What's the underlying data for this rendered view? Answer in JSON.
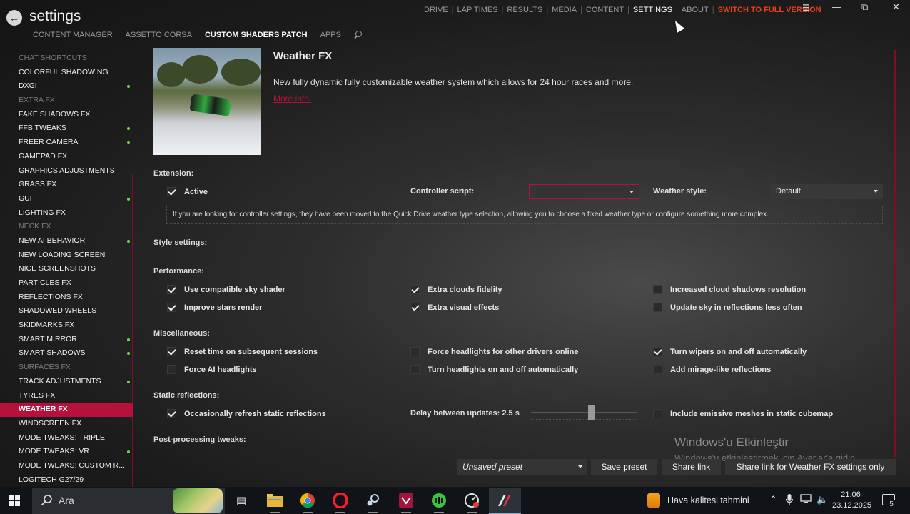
{
  "header": {
    "title": "settings",
    "nav": [
      "DRIVE",
      "LAP TIMES",
      "RESULTS",
      "MEDIA",
      "CONTENT",
      "SETTINGS",
      "ABOUT"
    ],
    "nav_active": "SETTINGS",
    "full_version": "SWITCH TO FULL VERSION",
    "subnav": [
      "CONTENT MANAGER",
      "ASSETTO CORSA",
      "CUSTOM SHADERS PATCH",
      "APPS"
    ],
    "subnav_active": "CUSTOM SHADERS PATCH"
  },
  "sidebar": {
    "items": [
      {
        "label": "CHAT SHORTCUTS",
        "dim": true,
        "dot": false
      },
      {
        "label": "COLORFUL SHADOWING",
        "dim": false,
        "dot": false
      },
      {
        "label": "DXGI",
        "dim": false,
        "dot": true
      },
      {
        "label": "EXTRA FX",
        "dim": true,
        "dot": false
      },
      {
        "label": "FAKE SHADOWS FX",
        "dim": false,
        "dot": false
      },
      {
        "label": "FFB TWEAKS",
        "dim": false,
        "dot": true
      },
      {
        "label": "FREER CAMERA",
        "dim": false,
        "dot": true
      },
      {
        "label": "GAMEPAD FX",
        "dim": false,
        "dot": false
      },
      {
        "label": "GRAPHICS ADJUSTMENTS",
        "dim": false,
        "dot": false
      },
      {
        "label": "GRASS FX",
        "dim": false,
        "dot": false
      },
      {
        "label": "GUI",
        "dim": false,
        "dot": true
      },
      {
        "label": "LIGHTING FX",
        "dim": false,
        "dot": false
      },
      {
        "label": "NECK FX",
        "dim": true,
        "dot": false
      },
      {
        "label": "NEW AI BEHAVIOR",
        "dim": false,
        "dot": true
      },
      {
        "label": "NEW LOADING SCREEN",
        "dim": false,
        "dot": false
      },
      {
        "label": "NICE SCREENSHOTS",
        "dim": false,
        "dot": false
      },
      {
        "label": "PARTICLES FX",
        "dim": false,
        "dot": false
      },
      {
        "label": "REFLECTIONS FX",
        "dim": false,
        "dot": false
      },
      {
        "label": "SHADOWED WHEELS",
        "dim": false,
        "dot": false
      },
      {
        "label": "SKIDMARKS FX",
        "dim": false,
        "dot": false
      },
      {
        "label": "SMART MIRROR",
        "dim": false,
        "dot": true
      },
      {
        "label": "SMART SHADOWS",
        "dim": false,
        "dot": true
      },
      {
        "label": "SURFACES FX",
        "dim": true,
        "dot": false
      },
      {
        "label": "TRACK ADJUSTMENTS",
        "dim": false,
        "dot": true
      },
      {
        "label": "TYRES FX",
        "dim": false,
        "dot": false
      },
      {
        "label": "WEATHER FX",
        "dim": false,
        "dot": false,
        "selected": true
      },
      {
        "label": "WINDSCREEN FX",
        "dim": false,
        "dot": false
      },
      {
        "label": "MODE TWEAKS: TRIPLE",
        "dim": false,
        "dot": false
      },
      {
        "label": "MODE TWEAKS: VR",
        "dim": false,
        "dot": true
      },
      {
        "label": "MODE TWEAKS: CUSTOM R...",
        "dim": false,
        "dot": false
      },
      {
        "label": "LOGITECH G27/29",
        "dim": false,
        "dot": false
      }
    ]
  },
  "content": {
    "title": "Weather FX",
    "description": "New fully dynamic fully customizable weather system which allows for 24 hour races and more.",
    "more_info": "More info",
    "sections": {
      "extension": "Extension:",
      "style": "Style settings:",
      "performance": "Performance:",
      "misc": "Miscellaneous:",
      "static": "Static reflections:",
      "post": "Post-processing tweaks:"
    },
    "active": {
      "label": "Active",
      "checked": true
    },
    "controller_script": {
      "label": "Controller script:",
      "value": ""
    },
    "weather_style": {
      "label": "Weather style:",
      "value": "Default"
    },
    "info": "If you are looking for controller settings, they have been moved to the Quick Drive weather type selection, allowing you to choose a fixed weather type or configure something more complex.",
    "performance": [
      {
        "label": "Use compatible sky shader",
        "checked": true
      },
      {
        "label": "Extra clouds fidelity",
        "checked": true
      },
      {
        "label": "Increased cloud shadows resolution",
        "checked": false
      },
      {
        "label": "Improve stars render",
        "checked": true
      },
      {
        "label": "Extra visual effects",
        "checked": true
      },
      {
        "label": "Update sky in reflections less often",
        "checked": false
      }
    ],
    "misc": [
      {
        "label": "Reset time on subsequent sessions",
        "checked": true
      },
      {
        "label": "Force headlights for other drivers online",
        "checked": false
      },
      {
        "label": "Turn wipers on and off automatically",
        "checked": true
      },
      {
        "label": "Force AI headlights",
        "checked": false
      },
      {
        "label": "Turn headlights on and off automatically",
        "checked": false
      },
      {
        "label": "Add mirage-like reflections",
        "checked": false
      }
    ],
    "static": {
      "refresh": {
        "label": "Occasionally refresh static reflections",
        "checked": true
      },
      "delay_label": "Delay between updates: 2.5 s",
      "delay_fraction": 0.57,
      "emissive": {
        "label": "Include emissive meshes in static cubemap",
        "checked": false
      }
    }
  },
  "bottom": {
    "preset": "Unsaved preset",
    "save": "Save preset",
    "share": "Share link",
    "share_only": "Share link for Weather FX settings only"
  },
  "watermark": {
    "line1": "Windows'u Etkinleştir",
    "line2": "Windows'u etkinleştirmek için Ayarlar'a gidin."
  },
  "taskbar": {
    "search": "Ara",
    "weather": "Hava kalitesi tahmini",
    "time": "21:06",
    "date": "23.12.2025",
    "notifications": "5"
  },
  "colors": {
    "accent": "#b5113a",
    "full_version": "#e8411e",
    "indicator": "#6ddd44"
  }
}
